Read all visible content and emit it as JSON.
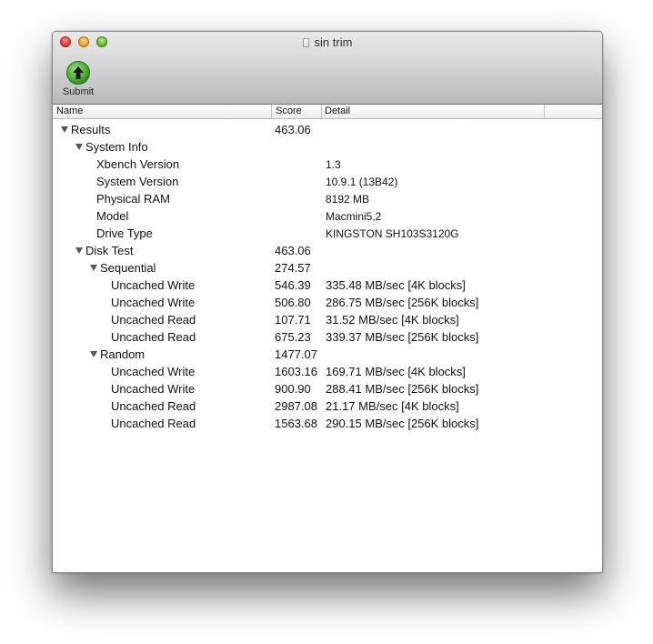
{
  "window": {
    "title": "sin trim"
  },
  "toolbar": {
    "submit_label": "Submit"
  },
  "columns": {
    "name": "Name",
    "score": "Score",
    "detail": "Detail"
  },
  "rows": [
    {
      "name": "Results",
      "score": "463.06",
      "detail": "",
      "level": 0,
      "group": true
    },
    {
      "name": "System Info",
      "score": "",
      "detail": "",
      "level": 1,
      "group": true
    },
    {
      "name": "Xbench Version",
      "score": "",
      "detail": "1.3",
      "level": 2,
      "group": false
    },
    {
      "name": "System Version",
      "score": "",
      "detail": "10.9.1 (13B42)",
      "level": 2,
      "group": false
    },
    {
      "name": "Physical RAM",
      "score": "",
      "detail": "8192 MB",
      "level": 2,
      "group": false
    },
    {
      "name": "Model",
      "score": "",
      "detail": "Macmini5,2",
      "level": 2,
      "group": false
    },
    {
      "name": "Drive Type",
      "score": "",
      "detail": "KINGSTON SH103S3120G",
      "level": 2,
      "group": false
    },
    {
      "name": "Disk Test",
      "score": "463.06",
      "detail": "",
      "level": 1,
      "group": true
    },
    {
      "name": "Sequential",
      "score": "274.57",
      "detail": "",
      "level": 2,
      "group": true
    },
    {
      "name": "Uncached Write",
      "score": "546.39",
      "detail": "335.48 MB/sec [4K blocks]",
      "level": 3,
      "group": false
    },
    {
      "name": "Uncached Write",
      "score": "506.80",
      "detail": "286.75 MB/sec [256K blocks]",
      "level": 3,
      "group": false
    },
    {
      "name": "Uncached Read",
      "score": "107.71",
      "detail": "31.52 MB/sec [4K blocks]",
      "level": 3,
      "group": false
    },
    {
      "name": "Uncached Read",
      "score": "675.23",
      "detail": "339.37 MB/sec [256K blocks]",
      "level": 3,
      "group": false
    },
    {
      "name": "Random",
      "score": "1477.07",
      "detail": "",
      "level": 2,
      "group": true
    },
    {
      "name": "Uncached Write",
      "score": "1603.16",
      "detail": "169.71 MB/sec [4K blocks]",
      "level": 3,
      "group": false
    },
    {
      "name": "Uncached Write",
      "score": "900.90",
      "detail": "288.41 MB/sec [256K blocks]",
      "level": 3,
      "group": false
    },
    {
      "name": "Uncached Read",
      "score": "2987.08",
      "detail": "21.17 MB/sec [4K blocks]",
      "level": 3,
      "group": false
    },
    {
      "name": "Uncached Read",
      "score": "1563.68",
      "detail": "290.15 MB/sec [256K blocks]",
      "level": 3,
      "group": false
    }
  ]
}
